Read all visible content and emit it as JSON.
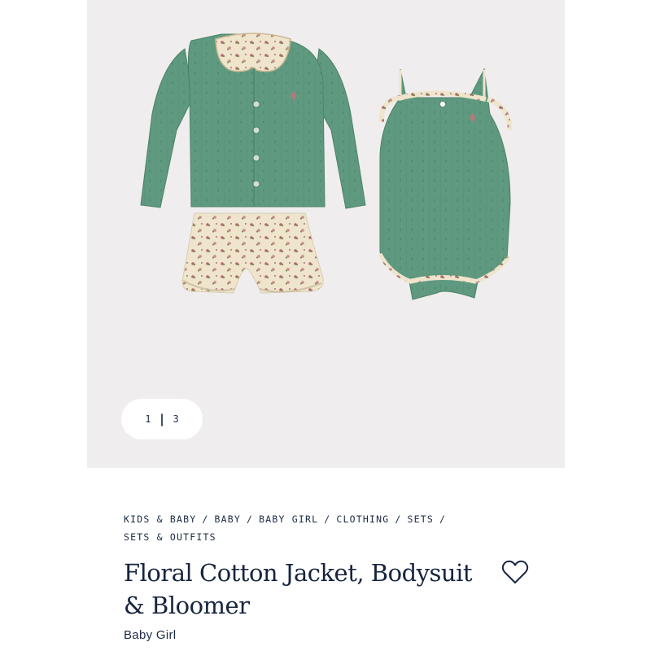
{
  "gallery": {
    "image_alt": "Green pointelle cardigan with floral collar, floral bloomer, and green floral-trim bodysuit",
    "pager": {
      "current": "1",
      "separator": "|",
      "total": "3"
    },
    "colors": {
      "background": "#efeded",
      "garment": "#5f9a80",
      "floral": "#efe4cc"
    }
  },
  "breadcrumb": [
    {
      "label": "KIDS & BABY"
    },
    {
      "label": "BABY"
    },
    {
      "label": "BABY GIRL"
    },
    {
      "label": "CLOTHING"
    },
    {
      "label": "SETS"
    },
    {
      "label": "SETS & OUTFITS"
    }
  ],
  "product": {
    "title": "Floral Cotton Jacket, Bodysuit & Bloomer",
    "subtitle": "Baby Girl",
    "wishlist_icon": "heart-outline-icon"
  },
  "theme": {
    "text": "#1b2a45"
  }
}
